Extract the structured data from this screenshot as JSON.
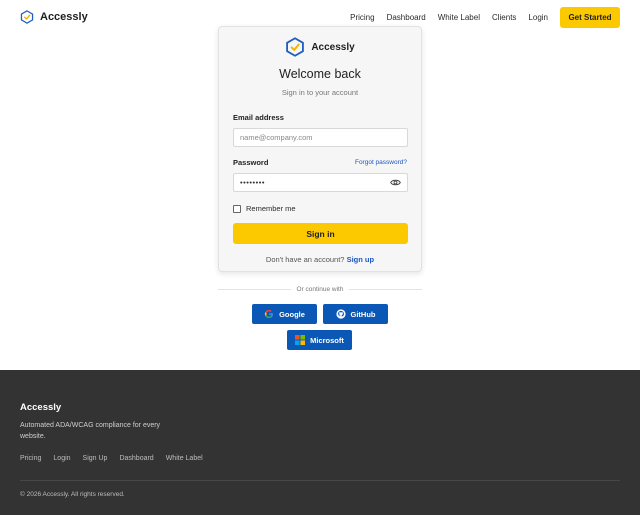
{
  "header": {
    "brand": "Accessly",
    "nav": [
      "Pricing",
      "Dashboard",
      "White Label",
      "Clients",
      "Login"
    ],
    "cta": "Get Started"
  },
  "login": {
    "brand": "Accessly",
    "title": "Welcome back",
    "subtitle": "Sign in to your account",
    "email_label": "Email address",
    "email_placeholder": "name@company.com",
    "password_label": "Password",
    "forgot": "Forgot password?",
    "password_value": "••••••••",
    "remember": "Remember me",
    "signin": "Sign in",
    "signup_prompt": "Don't have an account?",
    "signup_link": "Sign up"
  },
  "social": {
    "divider": "Or continue with",
    "google": "Google",
    "github": "GitHub",
    "microsoft": "Microsoft"
  },
  "footer": {
    "brand": "Accessly",
    "tagline": "Automated ADA/WCAG compliance for every website.",
    "links": [
      "Pricing",
      "Login",
      "Sign Up",
      "Dashboard",
      "White Label"
    ],
    "copyright": "© 2026 Accessly. All rights reserved."
  },
  "colors": {
    "accent": "#fcc800",
    "link": "#1a57c4",
    "oauth_button": "#0a57b5",
    "footer_bg": "#333333"
  },
  "icons": [
    "accessly-logo-icon",
    "eye-icon",
    "google-icon",
    "github-icon",
    "microsoft-icon"
  ]
}
